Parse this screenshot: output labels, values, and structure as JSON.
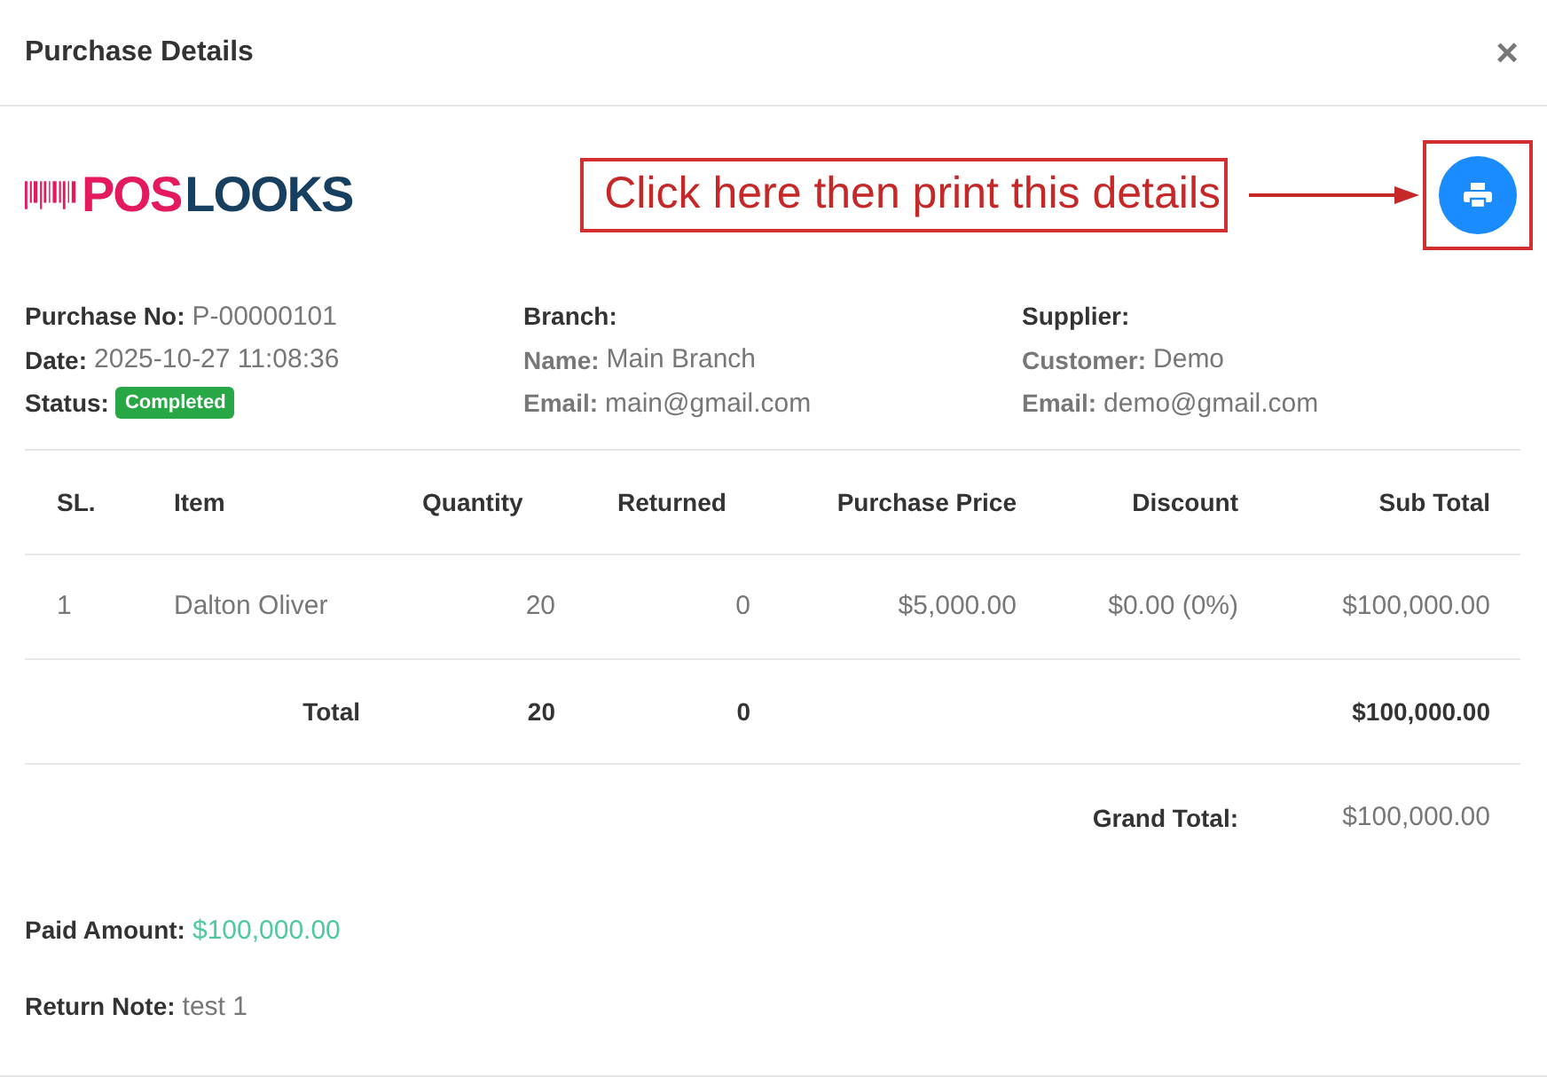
{
  "dialog": {
    "title": "Purchase Details",
    "close": "×"
  },
  "logo": {
    "part_1": "POS",
    "part_2": "LOOKS"
  },
  "annotation": {
    "text": "Click here then print this details"
  },
  "info_columns": [
    [
      {
        "kind": "field",
        "label": "Purchase No:",
        "value": "P-00000101"
      },
      {
        "kind": "field",
        "label": "Date:",
        "value": "2025-10-27 11:08:36"
      },
      {
        "kind": "badge",
        "label": "Status:",
        "value": "Completed"
      }
    ],
    [
      {
        "kind": "heading",
        "label": "Branch:"
      },
      {
        "kind": "subfield",
        "label": "Name:",
        "value": "Main Branch"
      },
      {
        "kind": "subfield",
        "label": "Email:",
        "value": "main@gmail.com"
      }
    ],
    [
      {
        "kind": "heading",
        "label": "Supplier:"
      },
      {
        "kind": "subfield",
        "label": "Customer:",
        "value": "Demo"
      },
      {
        "kind": "subfield",
        "label": "Email:",
        "value": "demo@gmail.com"
      }
    ]
  ],
  "table": {
    "columns": [
      {
        "label": "SL."
      },
      {
        "label": "Item"
      },
      {
        "label": "Quantity"
      },
      {
        "label": "Returned"
      },
      {
        "label": "Purchase Price"
      },
      {
        "label": "Discount"
      },
      {
        "label": "Sub Total"
      }
    ],
    "rows": [
      {
        "cells": [
          "1",
          "Dalton Oliver",
          "20",
          "0",
          "$5,000.00",
          "$0.00 (0%)",
          "$100,000.00"
        ]
      }
    ],
    "total": {
      "label": "Total",
      "quantity": "20",
      "returned": "0",
      "sub_total": "$100,000.00"
    },
    "grand_total": {
      "label": "Grand Total:",
      "value": "$100,000.00"
    }
  },
  "paid_amount": {
    "label": "Paid Amount:",
    "value": "$100,000.00"
  },
  "return_note": {
    "label": "Return Note:",
    "value": "test 1"
  }
}
